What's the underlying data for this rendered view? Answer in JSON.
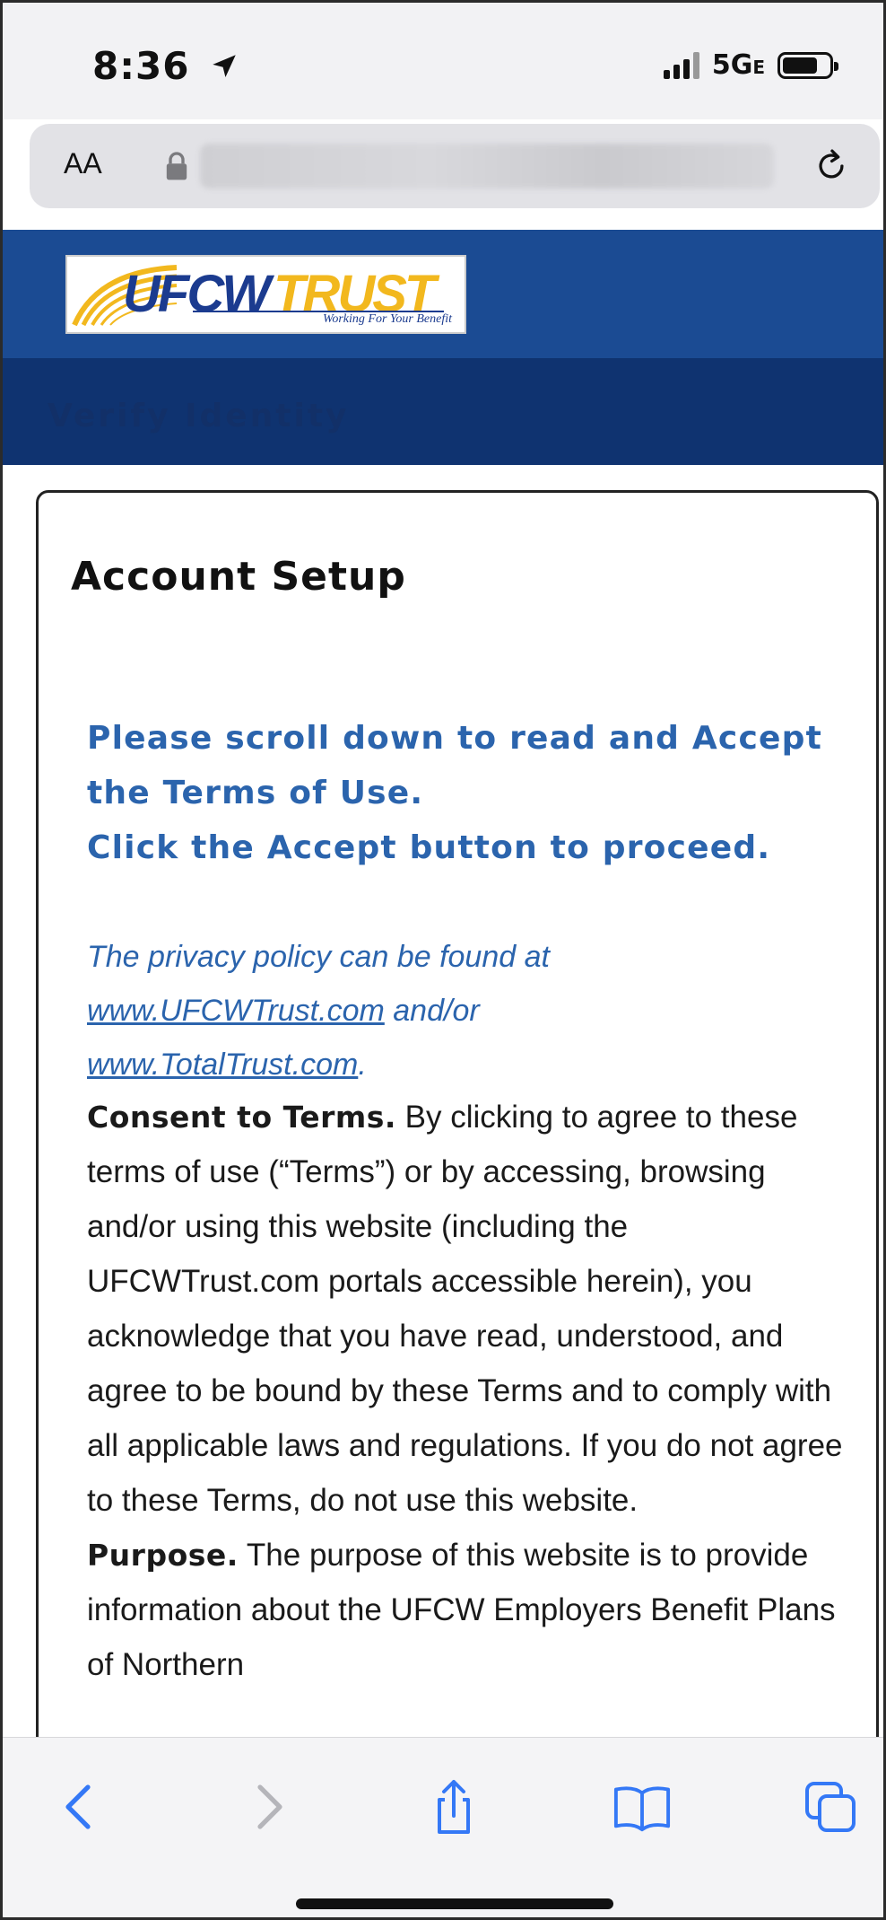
{
  "status_bar": {
    "time": "8:36",
    "network": "5G",
    "network_suffix": "E",
    "battery_level": 0.76
  },
  "url_bar": {
    "text_size_label": "AA"
  },
  "header": {
    "logo_word_1": "UFCW",
    "logo_word_2": "TRUST",
    "logo_tagline": "Working For Your Benefit",
    "verify_label": "Verify Identity"
  },
  "card": {
    "title": "Account Setup",
    "notice_line_1": "Please scroll down to read and Accept the Terms of Use.",
    "notice_line_2": "Click the Accept button to proceed.",
    "privacy_prefix": "The privacy policy can be found at",
    "privacy_link_1": "www.UFCWTrust.com",
    "privacy_join": "and/or",
    "privacy_link_2": "www.TotalTrust.com",
    "privacy_end": ".",
    "consent_heading": "Consent to Terms.",
    "consent_body": " By clicking to agree to these terms of use (“Terms”) or by accessing, browsing and/or using this website (including the UFCWTrust.com portals accessible herein), you acknowledge that you have read, understood, and agree to be bound by these Terms and to comply with all applicable laws and regulations. If you do not agree to these Terms, do not use this website.",
    "purpose_heading": "Purpose.",
    "purpose_body": " The purpose of this website is to provide information about the UFCW Employers Benefit Plans of Northern"
  },
  "colors": {
    "header_blue": "#1b4b93",
    "verify_bar": "#0f3370",
    "link_blue": "#2b64ad",
    "toolbar_icon": "#3478f6"
  },
  "toolbar": {
    "icons": [
      "back-icon",
      "forward-icon",
      "share-icon",
      "bookmarks-icon",
      "tabs-icon"
    ]
  }
}
